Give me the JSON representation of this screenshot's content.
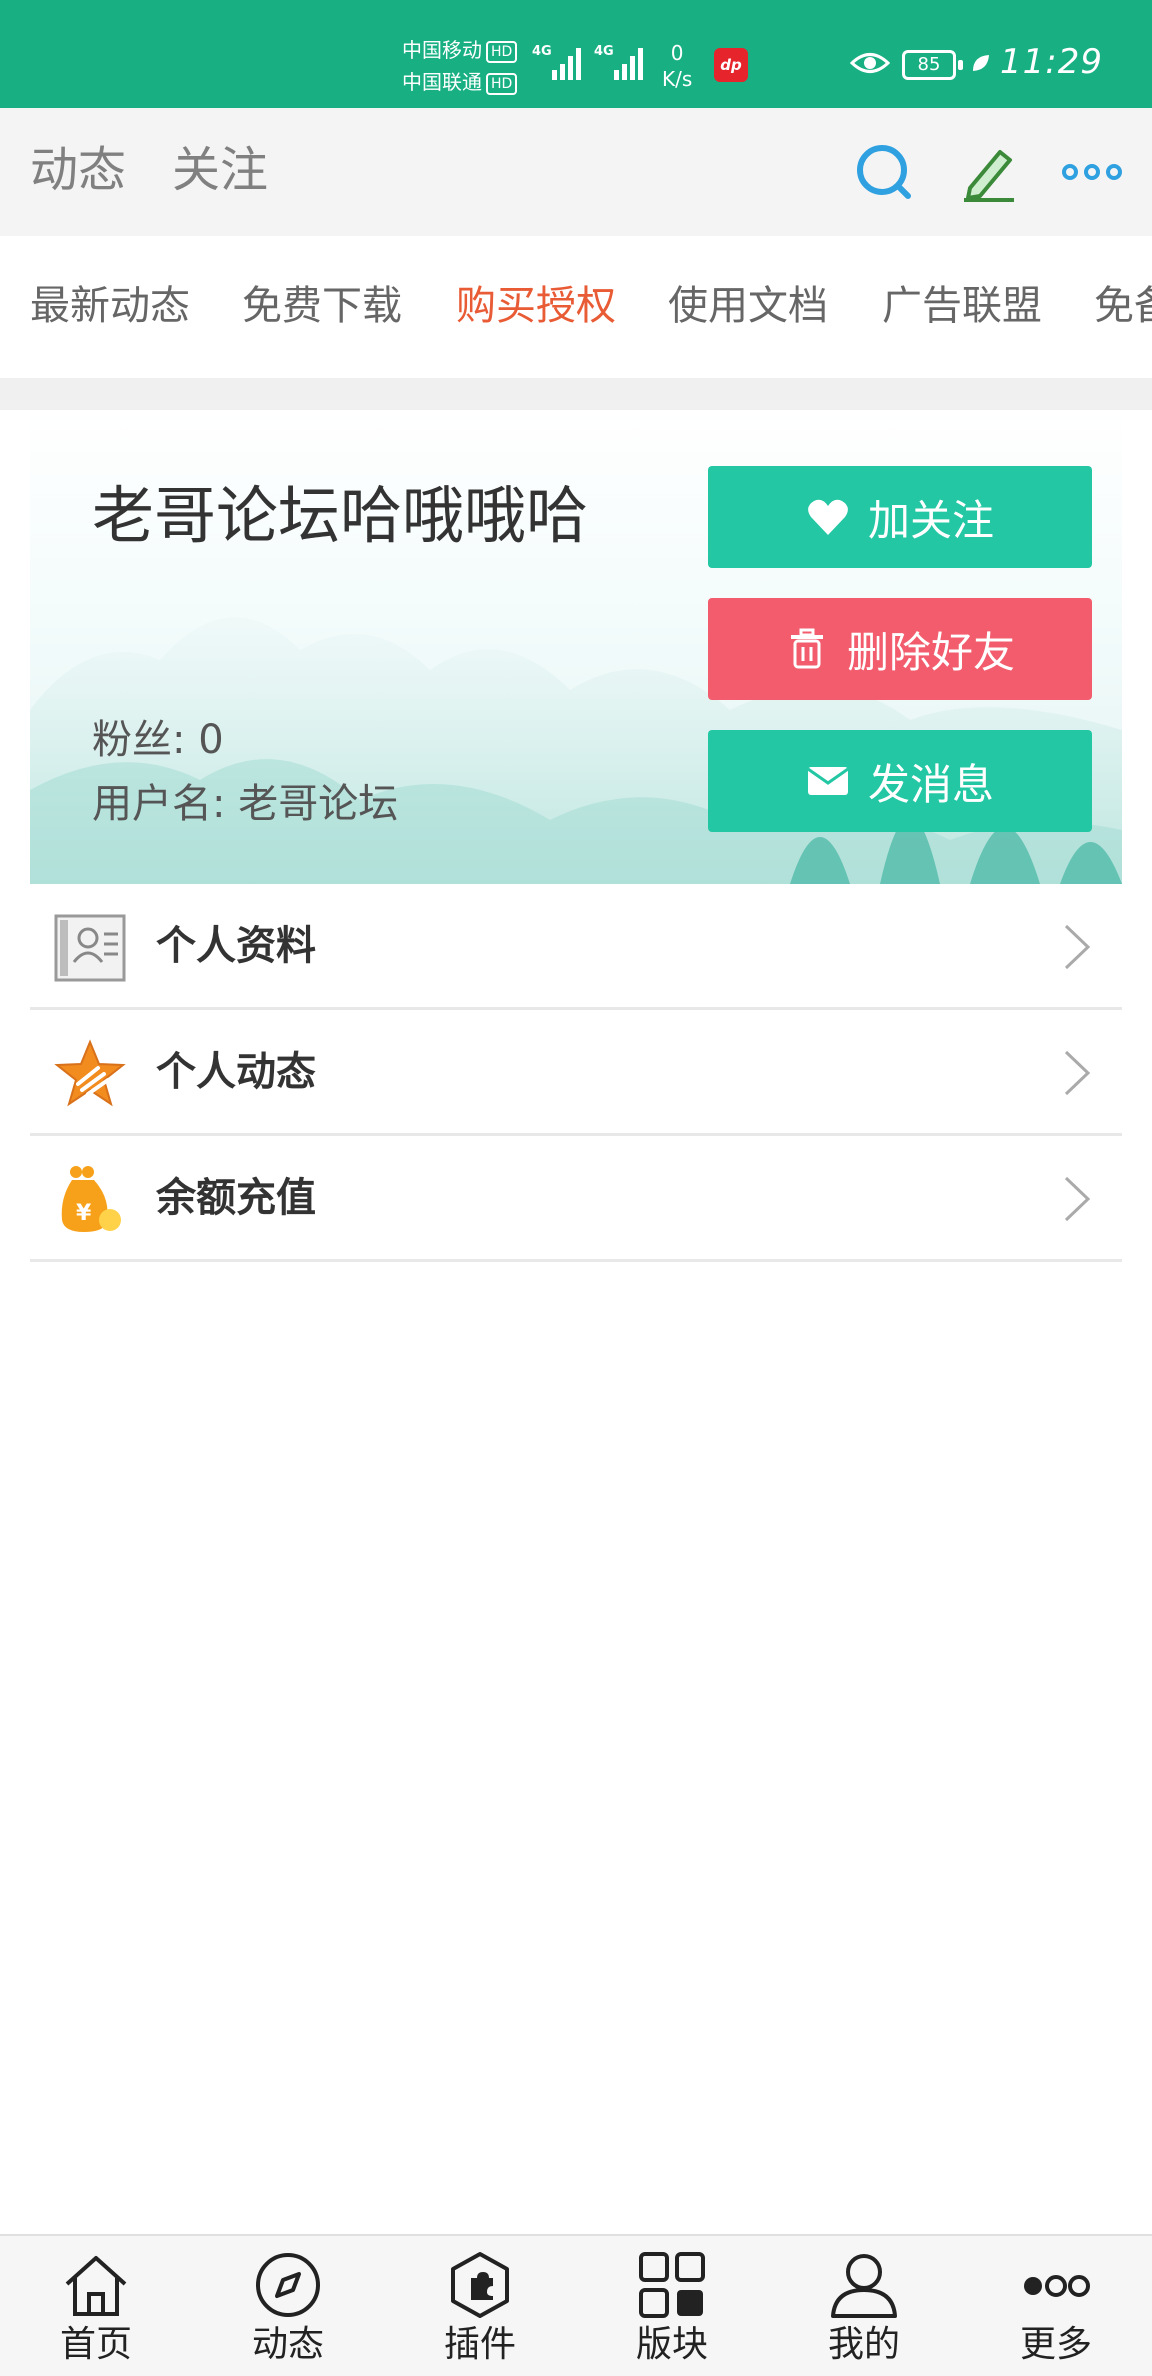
{
  "status_bar": {
    "carrier1": "中国移动",
    "carrier2": "中国联通",
    "hd": "HD",
    "net1": "4G",
    "net2": "4G",
    "speed_value": "0",
    "speed_unit": "K/s",
    "app_badge": "dp",
    "battery": "85",
    "time": "11:29"
  },
  "header": {
    "tabs": [
      "动态",
      "关注"
    ],
    "icons": [
      "search-icon",
      "edit-icon",
      "more-dots-icon"
    ]
  },
  "category_nav": {
    "items": [
      "最新动态",
      "免费下载",
      "购买授权",
      "使用文档",
      "广告联盟",
      "免备"
    ],
    "active_index": 2,
    "active_color": "#e85b35"
  },
  "profile": {
    "name": "老哥论坛哈哦哦哈",
    "fans_label": "粉丝:",
    "fans_value": "0",
    "username_label": "用户名:",
    "username_value": "老哥论坛",
    "buttons": {
      "follow": "加关注",
      "delete_friend": "删除好友",
      "message": "发消息"
    },
    "colors": {
      "teal": "#23c7a4",
      "red": "#f25c6d"
    }
  },
  "menu": {
    "items": [
      {
        "label": "个人资料",
        "icon": "profile-card-icon"
      },
      {
        "label": "个人动态",
        "icon": "star-icon"
      },
      {
        "label": "余额充值",
        "icon": "money-bag-icon"
      }
    ]
  },
  "tabbar": {
    "items": [
      {
        "label": "首页",
        "icon": "home-icon"
      },
      {
        "label": "动态",
        "icon": "compass-icon"
      },
      {
        "label": "插件",
        "icon": "plugin-icon"
      },
      {
        "label": "版块",
        "icon": "grid-icon"
      },
      {
        "label": "我的",
        "icon": "user-icon"
      },
      {
        "label": "更多",
        "icon": "more-icon"
      }
    ]
  },
  "theme": {
    "status_bar_color": "#18b083"
  }
}
